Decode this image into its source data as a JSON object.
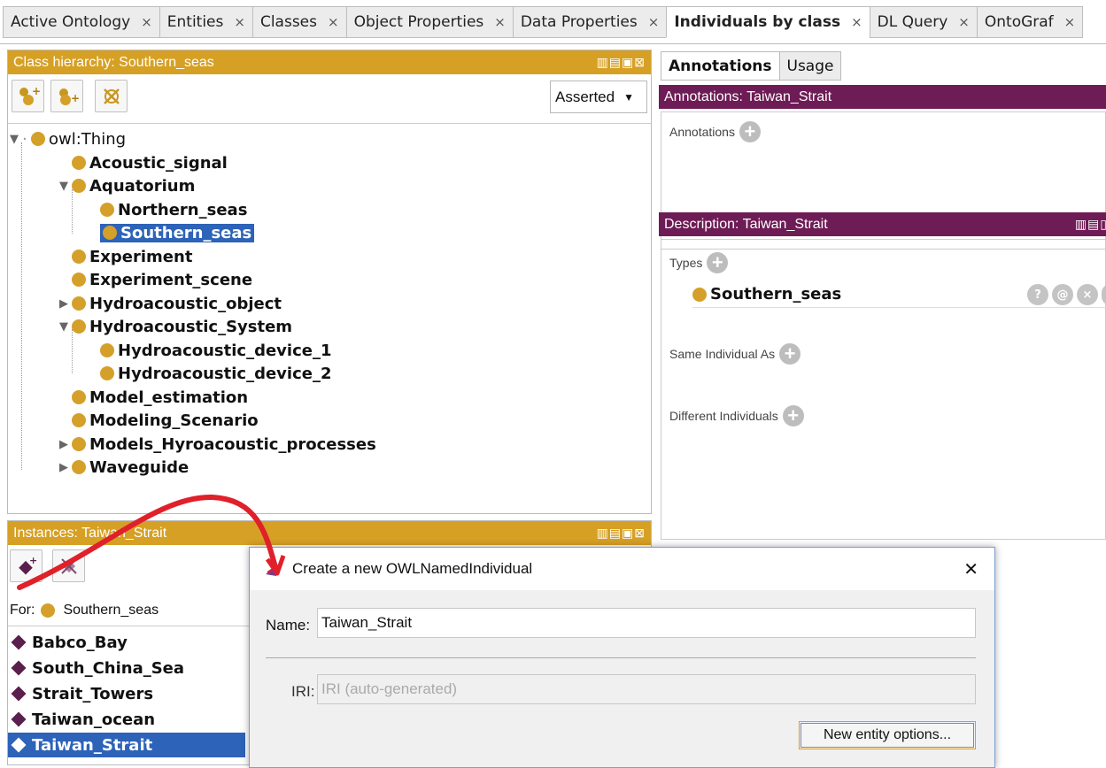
{
  "tabs": [
    {
      "label": "Active Ontology",
      "close": "×"
    },
    {
      "label": "Entities",
      "close": "×"
    },
    {
      "label": "Classes",
      "close": "×"
    },
    {
      "label": "Object Properties",
      "close": "×"
    },
    {
      "label": "Data Properties",
      "close": "×"
    },
    {
      "label": "Individuals by class",
      "close": "×",
      "active": true
    },
    {
      "label": "DL Query",
      "close": "×"
    },
    {
      "label": "OntoGraf",
      "close": "×"
    }
  ],
  "class_hierarchy": {
    "title": "Class hierarchy: Southern_seas",
    "mode_select": "Asserted",
    "tree": [
      {
        "label": "owl:Thing"
      },
      {
        "label": "Acoustic_signal"
      },
      {
        "label": "Aquatorium"
      },
      {
        "label": "Northern_seas"
      },
      {
        "label": "Southern_seas"
      },
      {
        "label": "Experiment"
      },
      {
        "label": "Experiment_scene"
      },
      {
        "label": "Hydroacoustic_object"
      },
      {
        "label": "Hydroacoustic_System"
      },
      {
        "label": "Hydroacoustic_device_1"
      },
      {
        "label": "Hydroacoustic_device_2"
      },
      {
        "label": "Model_estimation"
      },
      {
        "label": "Modeling_Scenario"
      },
      {
        "label": "Models_Hyroacoustic_processes"
      },
      {
        "label": "Waveguide"
      }
    ]
  },
  "instances": {
    "title": "Instances: Taiwan_Strait",
    "for_label": "For:",
    "for_value": "Southern_seas",
    "items": [
      "Babco_Bay",
      "South_China_Sea",
      "Strait_Towers",
      "Taiwan_ocean",
      "Taiwan_Strait"
    ]
  },
  "right_tabs": [
    "Annotations",
    "Usage"
  ],
  "annotations": {
    "title": "Annotations: Taiwan_Strait",
    "label": "Annotations"
  },
  "description": {
    "title": "Description: Taiwan_Strait",
    "types_label": "Types",
    "type_value": "Southern_seas",
    "same_label": "Same Individual As",
    "different_label": "Different Individuals",
    "row_buttons": [
      "?",
      "@",
      "×"
    ]
  },
  "dialog": {
    "title": "Create a new OWLNamedIndividual",
    "close": "✕",
    "name_label": "Name:",
    "name_value": "Taiwan_Strait",
    "iri_label": "IRI:",
    "iri_placeholder": "IRI (auto-generated)",
    "options_button": "New entity options..."
  },
  "colors": {
    "gold": "#d6a024",
    "purple": "#6e1c55",
    "selection": "#2d63b8",
    "arrow": "#e0202a"
  }
}
